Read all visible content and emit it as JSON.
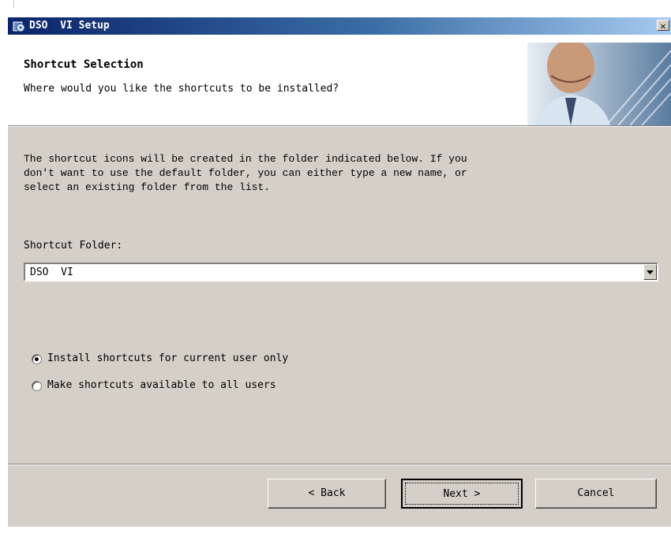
{
  "window": {
    "title": "DSO  VI Setup",
    "close_symbol": "✕",
    "icon": "setup-disk-icon"
  },
  "header": {
    "title": "Shortcut Selection",
    "subtitle": "Where would you like the shortcuts to be installed?"
  },
  "body": {
    "description": "The shortcut icons will be created in the folder indicated below. If you\ndon't want to use the default folder, you can either type a new name, or\nselect an existing folder from the list.",
    "folder_label": "Shortcut Folder:",
    "folder_value": "DSO  VI"
  },
  "options": [
    {
      "label": "Install shortcuts for current user only",
      "selected": true
    },
    {
      "label": "Make shortcuts available to all users",
      "selected": false
    }
  ],
  "buttons": {
    "back": "< Back",
    "next": "Next >",
    "cancel": "Cancel"
  },
  "colors": {
    "titlebar_start": "#0a246a",
    "titlebar_end": "#a6caf0",
    "dialog_face": "#d4d0c8"
  }
}
